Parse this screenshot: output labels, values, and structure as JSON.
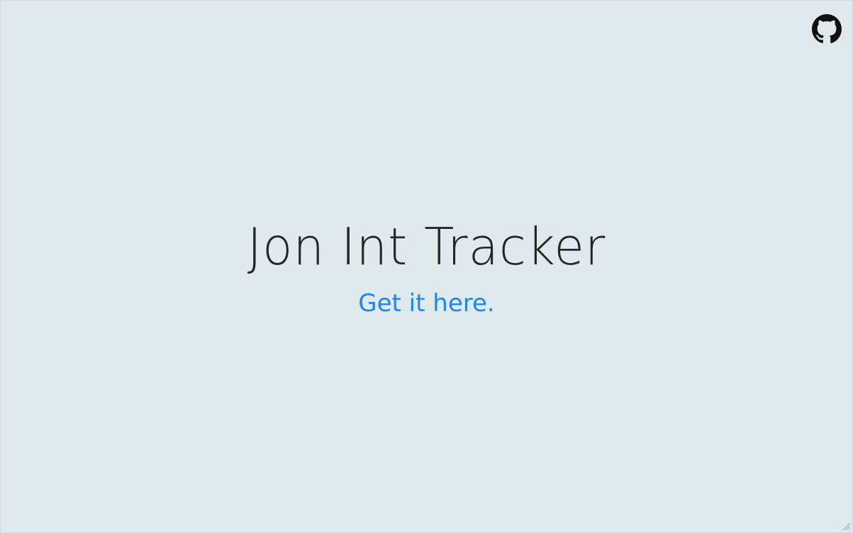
{
  "page": {
    "title": "Jon Int Tracker",
    "cta_label": "Get it here."
  },
  "header": {
    "github_link_icon": "github-icon"
  },
  "colors": {
    "background": "#e0e9ec",
    "title_text": "#23272b",
    "link": "#1f85f2",
    "icon": "#111111"
  }
}
